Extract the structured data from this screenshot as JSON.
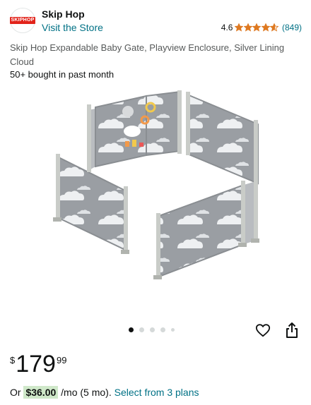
{
  "store": {
    "logo_text": "SKIPHOP",
    "brand_name": "Skip Hop",
    "visit_store_label": "Visit the Store"
  },
  "rating": {
    "value": "4.6",
    "stars": 4.6,
    "count": "(849)",
    "star_color": "#de7921"
  },
  "product": {
    "title": "Skip Hop Expandable Baby Gate, Playview Enclosure, Silver Lining Cloud",
    "bought_text": "50+ bought in past month",
    "image_icon": "baby-gate-playpen-image"
  },
  "carousel": {
    "active_index": 0,
    "dot_count": 5
  },
  "actions": {
    "wishlist_icon": "heart-outline-icon",
    "share_icon": "share-icon"
  },
  "price": {
    "symbol": "$",
    "whole": "179",
    "fraction": "99"
  },
  "plan": {
    "prefix": "Or",
    "amount": "$36.00",
    "suffix": "/mo (5 mo).",
    "link": "Select from 3 plans",
    "highlight_color": "#cfe8c9"
  },
  "colors": {
    "link": "#007185",
    "text": "#0f1111",
    "secondary_text": "#565959"
  }
}
